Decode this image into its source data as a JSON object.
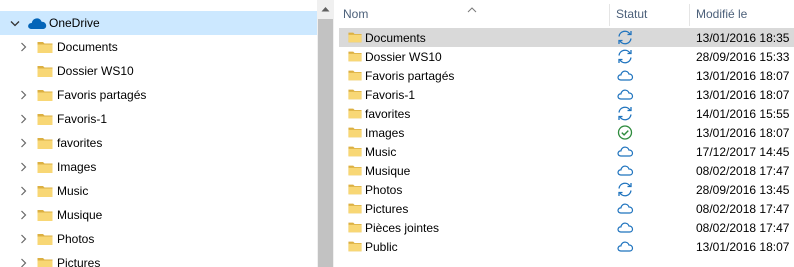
{
  "nav": {
    "onedrive_label": "OneDrive",
    "items": [
      {
        "label": "Documents",
        "expandable": true
      },
      {
        "label": "Dossier WS10",
        "expandable": false
      },
      {
        "label": "Favoris partagés",
        "expandable": true
      },
      {
        "label": "Favoris-1",
        "expandable": true
      },
      {
        "label": "favorites",
        "expandable": true
      },
      {
        "label": "Images",
        "expandable": true
      },
      {
        "label": "Music",
        "expandable": true
      },
      {
        "label": "Musique",
        "expandable": true
      },
      {
        "label": "Photos",
        "expandable": true
      },
      {
        "label": "Pictures",
        "expandable": true
      }
    ]
  },
  "columns": {
    "name": "Nom",
    "status": "Statut",
    "modified": "Modifié le"
  },
  "files": [
    {
      "name": "Documents",
      "status": "sync",
      "modified": "13/01/2016 18:35"
    },
    {
      "name": "Dossier WS10",
      "status": "sync",
      "modified": "28/09/2016 15:33"
    },
    {
      "name": "Favoris partagés",
      "status": "cloud",
      "modified": "13/01/2016 18:07"
    },
    {
      "name": "Favoris-1",
      "status": "cloud",
      "modified": "13/01/2016 18:07"
    },
    {
      "name": "favorites",
      "status": "sync",
      "modified": "14/01/2016 15:55"
    },
    {
      "name": "Images",
      "status": "available",
      "modified": "13/01/2016 18:07"
    },
    {
      "name": "Music",
      "status": "cloud",
      "modified": "17/12/2017 14:45"
    },
    {
      "name": "Musique",
      "status": "cloud",
      "modified": "08/02/2018 17:47"
    },
    {
      "name": "Photos",
      "status": "sync",
      "modified": "28/09/2016 13:45"
    },
    {
      "name": "Pictures",
      "status": "cloud",
      "modified": "08/02/2018 17:47"
    },
    {
      "name": "Pièces jointes",
      "status": "cloud",
      "modified": "08/02/2018 17:47"
    },
    {
      "name": "Public",
      "status": "cloud",
      "modified": "13/01/2016 18:07"
    }
  ],
  "colors": {
    "folder": "#f8d775",
    "folder_dark": "#dcb042",
    "onedrive": "#0364b8",
    "status_blue": "#1e73be",
    "status_green": "#2e8b3d",
    "selection_nav": "#cce8ff",
    "selection_list": "#d9d9d9"
  }
}
